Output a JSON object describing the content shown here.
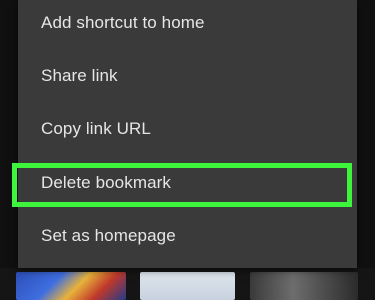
{
  "context_menu": {
    "items": [
      {
        "label": "Add shortcut to home"
      },
      {
        "label": "Share link"
      },
      {
        "label": "Copy link URL"
      },
      {
        "label": "Delete bookmark"
      },
      {
        "label": "Set as homepage"
      }
    ]
  },
  "highlight": {
    "target": "Delete bookmark",
    "color": "#3cf53c"
  },
  "colors": {
    "menu_background": "#3a3a3a",
    "menu_text": "#e6e6e6",
    "backdrop": "#1a1a1a"
  }
}
